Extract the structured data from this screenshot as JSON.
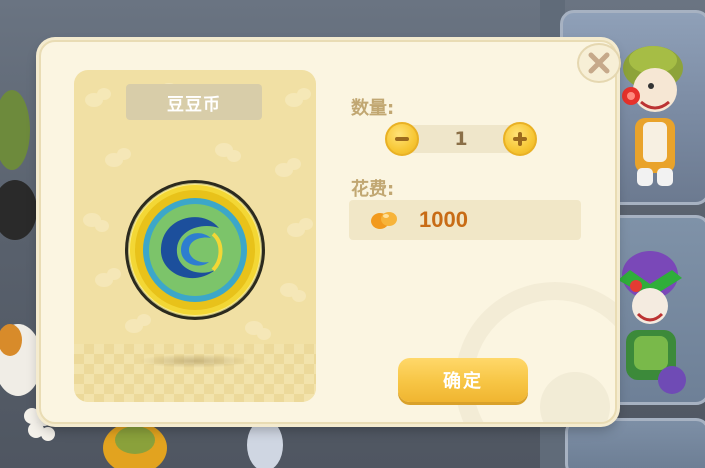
{
  "dialog": {
    "item_name": "豆豆币",
    "quantity_label": "数量:",
    "quantity_value": "1",
    "cost_label": "花费:",
    "cost_amount": "1000",
    "confirm_label": "确定"
  },
  "colors": {
    "dialog_bg": "#fbf5e1",
    "label": "#c1a772",
    "accent_yellow": "#f7c544",
    "cost_text": "#c86c16"
  },
  "icons": {
    "close": "close-icon",
    "minus": "minus-icon",
    "plus": "plus-icon",
    "currency": "bean-icon",
    "item": "coin-icon"
  }
}
